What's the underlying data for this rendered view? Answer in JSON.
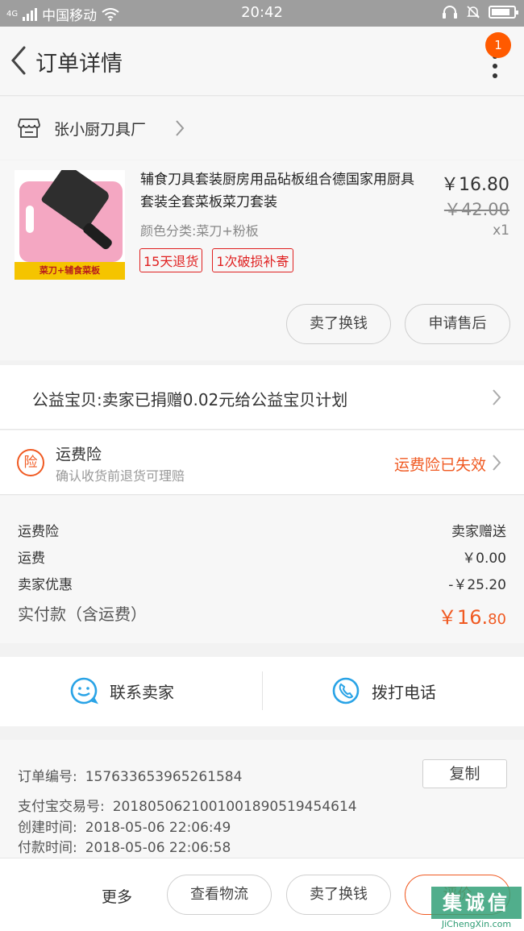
{
  "status_bar": {
    "network": "4G",
    "carrier": "中国移动",
    "time": "20:42"
  },
  "header": {
    "title": "订单详情",
    "badge_count": "1"
  },
  "shop": {
    "name": "张小厨刀具厂"
  },
  "product": {
    "title": "辅食刀具套装厨房用品砧板组合德国家用厨具套装全套菜板菜刀套装",
    "thumb_banner": "菜刀+辅食菜板",
    "sku": "颜色分类:菜刀+粉板",
    "tags": [
      "15天退货",
      "1次破损补寄"
    ],
    "price": "￥16.80",
    "original_price": "￥42.00",
    "quantity": "x1",
    "actions": {
      "sell": "卖了换钱",
      "after_sale": "申请售后"
    }
  },
  "charity": {
    "text": "公益宝贝:卖家已捐赠0.02元给公益宝贝计划"
  },
  "insurance": {
    "icon_char": "险",
    "title": "运费险",
    "subtitle": "确认收货前退货可理赔",
    "status": "运费险已失效"
  },
  "costs": {
    "rows": [
      {
        "label": "运费险",
        "value": "卖家赠送"
      },
      {
        "label": "运费",
        "value": "￥0.00"
      },
      {
        "label": "卖家优惠",
        "value": "-￥25.20"
      }
    ],
    "total_label": "实付款（含运费）",
    "total_main": "￥16.",
    "total_cents": "80"
  },
  "contact": {
    "seller": "联系卖家",
    "phone": "拨打电话"
  },
  "order_info": {
    "order_no_label": "订单编号:",
    "order_no": "157633653965261584",
    "copy_label": "复制",
    "alipay_label": "支付宝交易号:",
    "alipay_no": "2018050621001001890519454614",
    "created_label": "创建时间:",
    "created": "2018-05-06 22:06:49",
    "paid_label": "付款时间:",
    "paid": "2018-05-06 22:06:58"
  },
  "bottom_bar": {
    "more": "更多",
    "logistics": "查看物流",
    "sell": "卖了换钱",
    "review": "评价"
  },
  "watermark": {
    "logo": "集诚信",
    "url": "JiChengXin.com"
  },
  "colors": {
    "accent_orange": "#f05a22",
    "tag_red": "#e02020",
    "contact_blue": "#29a3e6",
    "status_bar": "#9e9e9e"
  }
}
